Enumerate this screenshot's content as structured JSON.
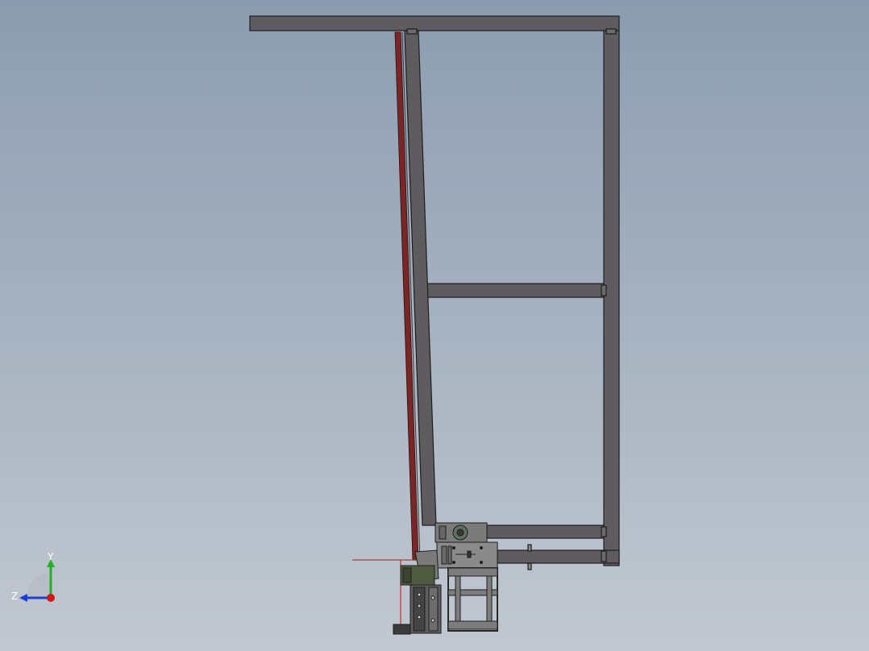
{
  "viewport": {
    "background_top": "#8c9cb0",
    "background_bottom": "#c1c8d1"
  },
  "model": {
    "frame_color": "#5e5c5e",
    "frame_edge_color": "#1e1e1e",
    "belt_color": "#7a2626",
    "sketch_line_color": "#b01c1c",
    "bracket_color": "#4f5a3e"
  },
  "triad": {
    "y_label": "Y",
    "z_label": "Z",
    "y_color": "#1fb51f",
    "z_color": "#1a3fd6",
    "x_color": "#d01818"
  }
}
